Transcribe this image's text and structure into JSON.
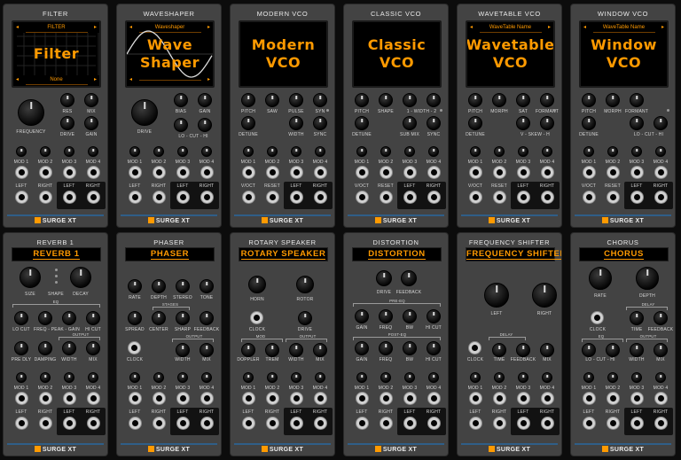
{
  "footer_label": "SURGE XT",
  "colors": {
    "accent": "#ff9a00",
    "panel": "#434343",
    "jack": "#d0d0d0",
    "rule": "#2f5e88"
  },
  "vco_modules": [
    {
      "title": "FILTER",
      "display_top": "FILTER",
      "display_main": "Filter",
      "display_bottom": "None",
      "knobs": [
        "FREQUENCY",
        "RES",
        "MIX",
        "DRIVE",
        "GAIN"
      ],
      "outputs": [
        "LEFT",
        "RIGHT",
        "LEFT",
        "RIGHT"
      ]
    },
    {
      "title": "WAVESHAPER",
      "display_top": "Waveshaper",
      "display_main": "Wave Shaper",
      "display_bottom": "",
      "knobs": [
        "DRIVE",
        "BIAS",
        "GAIN",
        "LO - CUT - HI"
      ],
      "outputs": [
        "LEFT",
        "RIGHT",
        "LEFT",
        "RIGHT"
      ]
    },
    {
      "title": "MODERN VCO",
      "display_main": "Modern VCO",
      "knobs": [
        "PITCH",
        "SAW",
        "PULSE",
        "SYN",
        "DETUNE",
        "WIDTH",
        "SYNC"
      ],
      "outputs": [
        "V/OCT",
        "RESET",
        "LEFT",
        "RIGHT"
      ]
    },
    {
      "title": "CLASSIC VCO",
      "display_main": "Classic VCO",
      "knobs": [
        "PITCH",
        "SHAPE",
        "1 - WIDTH - 2",
        "DETUNE",
        "SUB MIX",
        "SYNC"
      ],
      "outputs": [
        "V/OCT",
        "RESET",
        "LEFT",
        "RIGHT"
      ]
    },
    {
      "title": "WAVETABLE VCO",
      "display_top": "WaveTable Name",
      "display_main": "Wavetable VCO",
      "knobs": [
        "PITCH",
        "MORPH",
        "SAT",
        "FORMANT",
        "DETUNE",
        "V - SKEW - H"
      ],
      "outputs": [
        "V/OCT",
        "RESET",
        "LEFT",
        "RIGHT"
      ]
    },
    {
      "title": "WINDOW VCO",
      "display_top": "WaveTable Name",
      "display_main": "Window VCO",
      "knobs": [
        "PITCH",
        "MORPH",
        "FORMANT",
        "DETUNE",
        "LO - CUT - HI"
      ],
      "outputs": [
        "V/OCT",
        "RESET",
        "LEFT",
        "RIGHT"
      ]
    }
  ],
  "fx_modules": [
    {
      "title": "REVERB 1",
      "header": "REVERB 1",
      "labels": [
        "SIZE",
        "SHAPE",
        "DECAY",
        "EQ",
        "LO CUT",
        "FREQ - PEAK - GAIN",
        "HI CUT",
        "OUTPUT",
        "PRE DLY",
        "DAMPING",
        "WIDTH",
        "MIX"
      ],
      "outputs": [
        "LEFT",
        "RIGHT",
        "LEFT",
        "RIGHT"
      ]
    },
    {
      "title": "PHASER",
      "header": "PHASER",
      "labels": [
        "RATE",
        "DEPTH",
        "STEREO",
        "TONE",
        "STAGES",
        "SPREAD",
        "CENTER",
        "SHARP",
        "FEEDBACK",
        "OUTPUT",
        "CLOCK",
        "WIDTH",
        "MIX"
      ],
      "outputs": [
        "LEFT",
        "RIGHT",
        "LEFT",
        "RIGHT"
      ]
    },
    {
      "title": "ROTARY SPEAKER",
      "header": "ROTARY SPEAKER",
      "labels": [
        "HORN",
        "ROTOR",
        "CLOCK",
        "DRIVE",
        "MOD",
        "OUTPUT",
        "DOPPLER",
        "TREM",
        "WIDTH",
        "MIX"
      ],
      "outputs": [
        "LEFT",
        "RIGHT",
        "LEFT",
        "RIGHT"
      ]
    },
    {
      "title": "DISTORTION",
      "header": "DISTORTION",
      "labels": [
        "DRIVE",
        "FEEDBACK",
        "PRE-EQ",
        "GAIN",
        "FREQ",
        "BW",
        "HI CUT",
        "POST-EQ",
        "GAIN",
        "FREQ",
        "BW",
        "HI CUT"
      ],
      "outputs": [
        "LEFT",
        "RIGHT",
        "LEFT",
        "RIGHT"
      ]
    },
    {
      "title": "FREQUENCY SHIFTER",
      "header": "FREQUENCY SHIFTER",
      "labels": [
        "LEFT",
        "RIGHT",
        "DELAY",
        "CLOCK",
        "TIME",
        "FEEDBACK",
        "MIX"
      ],
      "outputs": [
        "LEFT",
        "RIGHT",
        "LEFT",
        "RIGHT"
      ]
    },
    {
      "title": "CHORUS",
      "header": "CHORUS",
      "labels": [
        "RATE",
        "DEPTH",
        "DELAY",
        "CLOCK",
        "TIME",
        "FEEDBACK",
        "EQ",
        "OUTPUT",
        "LO - CUT - HI",
        "WIDTH",
        "MIX"
      ],
      "outputs": [
        "LEFT",
        "RIGHT",
        "LEFT",
        "RIGHT"
      ]
    }
  ],
  "mod_labels": [
    "MOD 1",
    "MOD 2",
    "MOD 3",
    "MOD 4"
  ],
  "display_arrow_left": "◂",
  "display_arrow_right": "▸"
}
